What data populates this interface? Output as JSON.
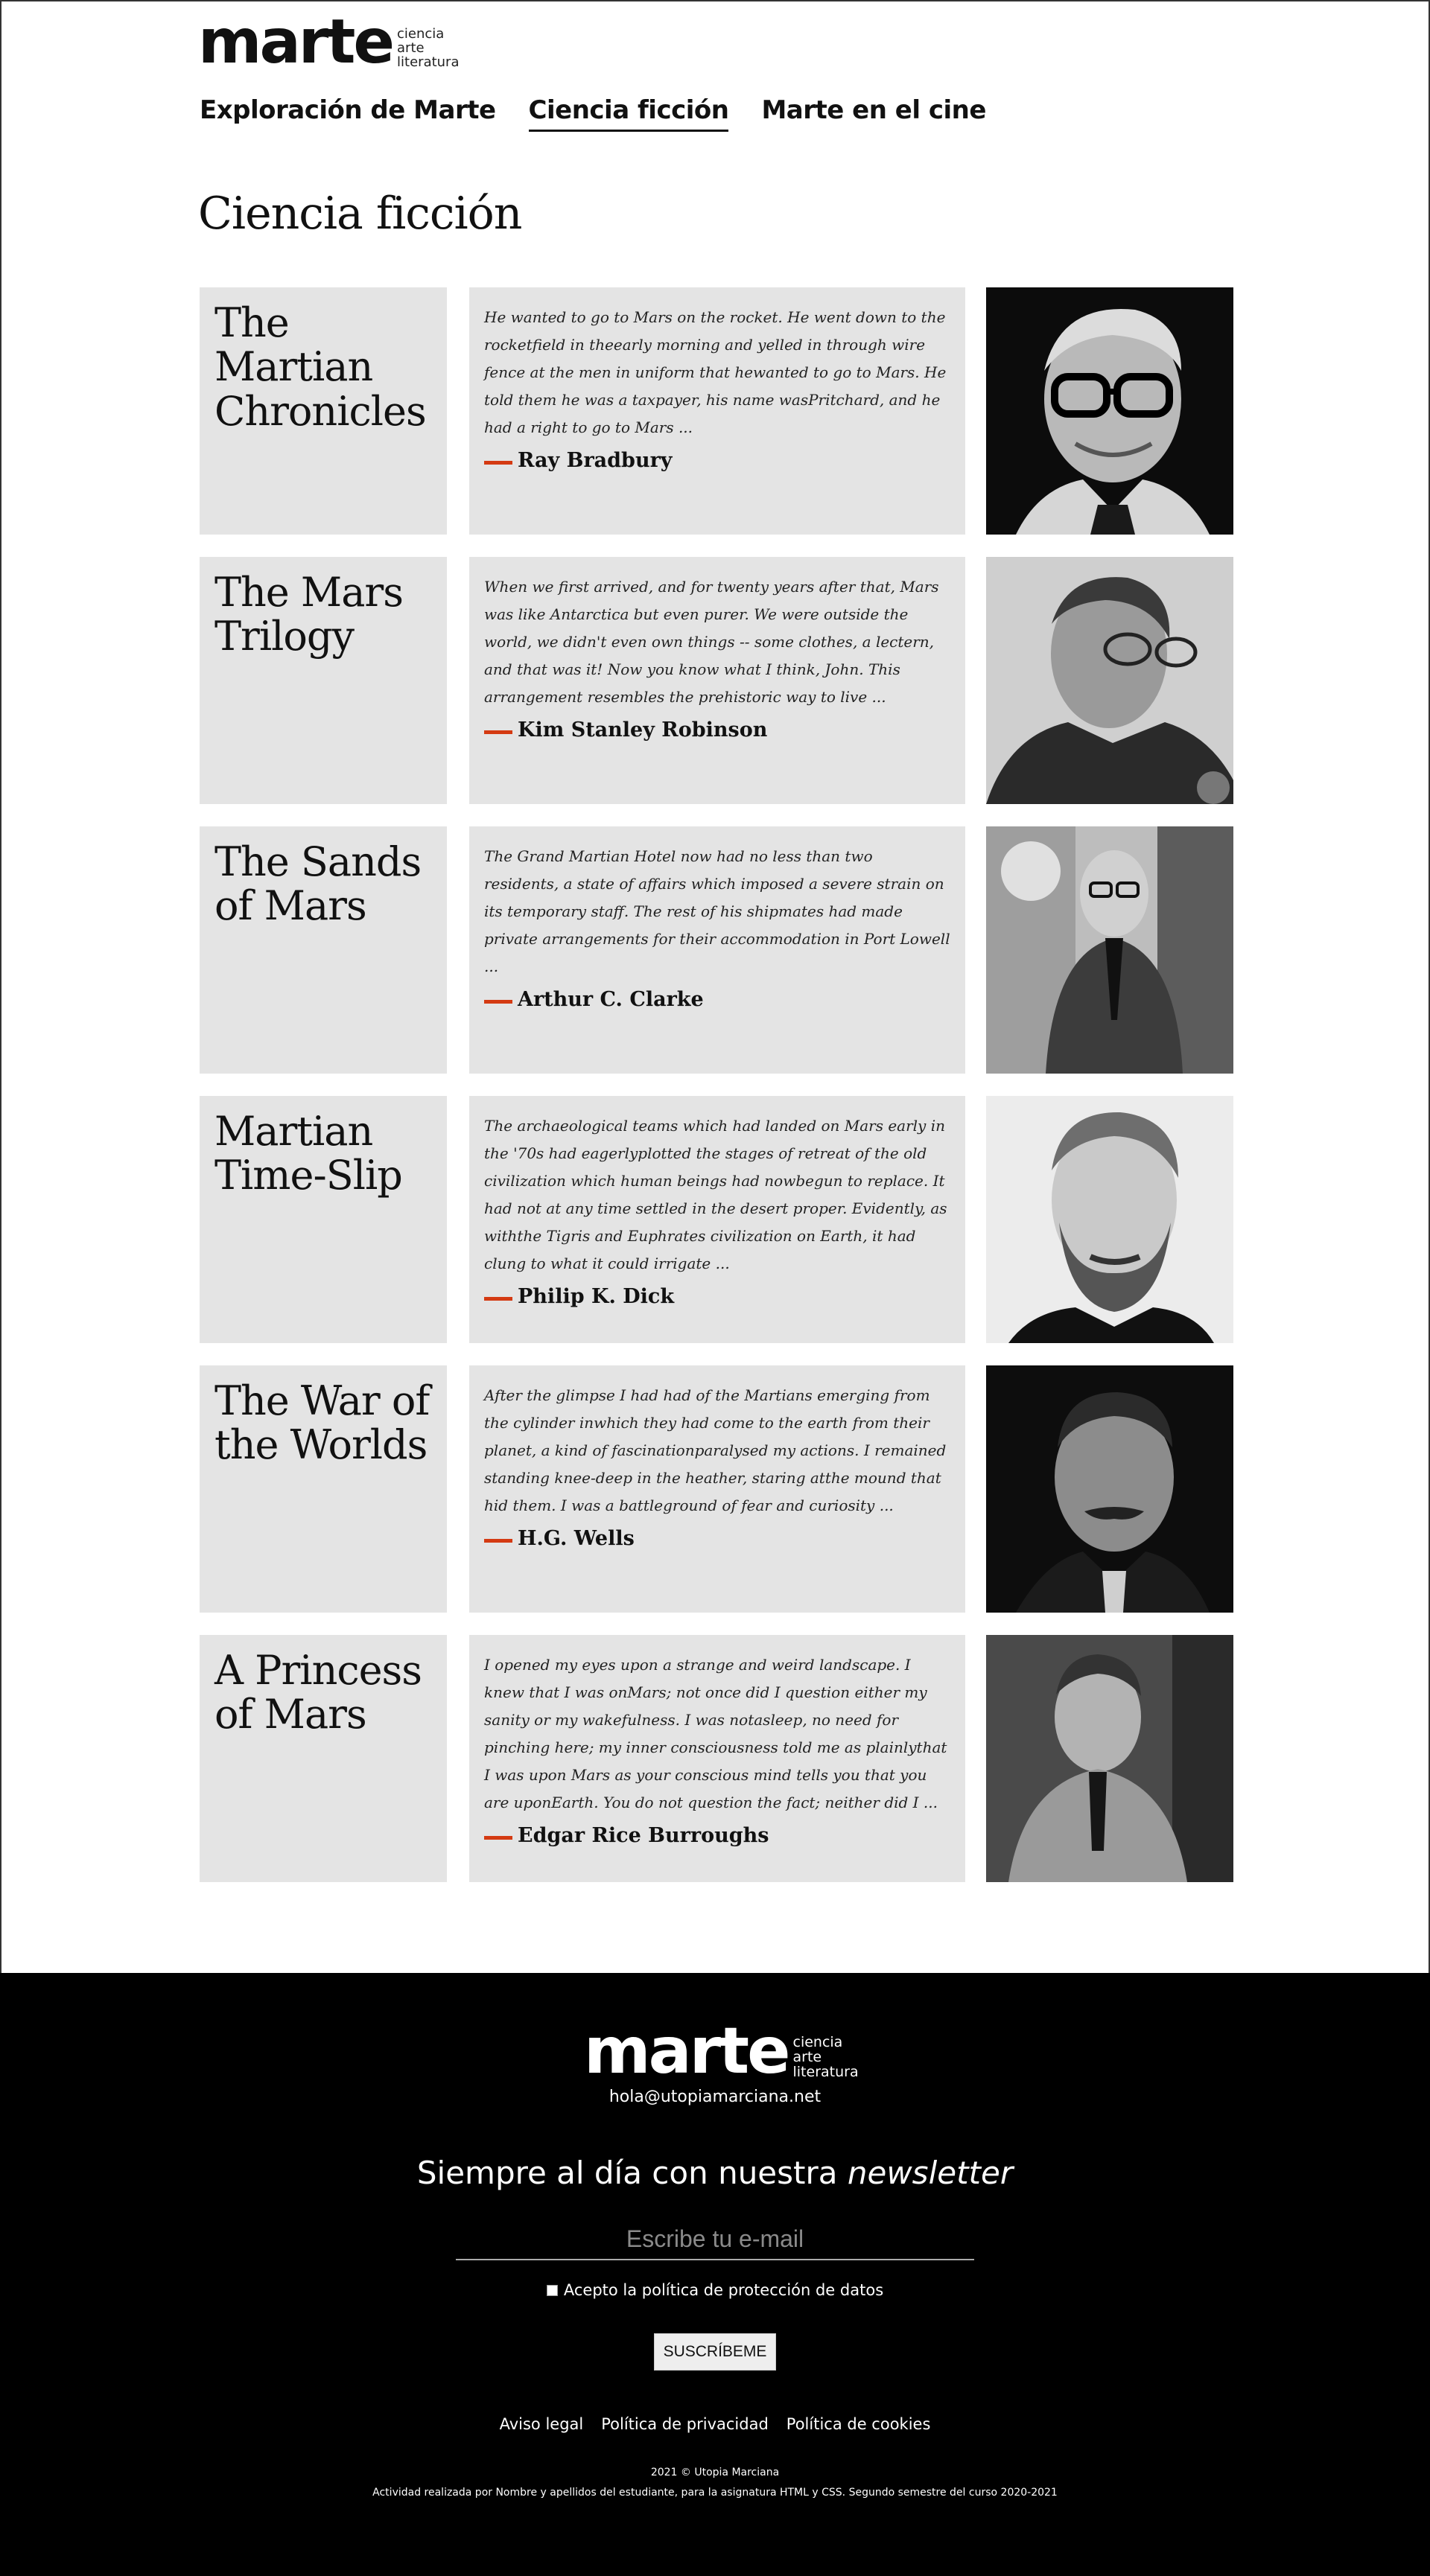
{
  "brand": {
    "name": "marte",
    "tagline": [
      "ciencia",
      "arte",
      "literatura"
    ]
  },
  "nav": [
    {
      "label": "Exploración de Marte",
      "active": false
    },
    {
      "label": "Ciencia ficción",
      "active": true
    },
    {
      "label": "Marte en el cine",
      "active": false
    }
  ],
  "page": {
    "title": "Ciencia ficción"
  },
  "entries": [
    {
      "title": "The Martian Chronicles",
      "quote": "He wanted to go to Mars on the rocket. He went down to the rocketfield in theearly morning and yelled in through wire fence at the men in uniform that hewanted to go to Mars. He told them he was a taxpayer, his name wasPritchard, and he had a right to go to Mars ...",
      "author": "Ray Bradbury"
    },
    {
      "title": "The Mars Trilogy",
      "quote": "When we first arrived, and for twenty years after that, Mars was like Antarctica but even purer. We were outside the world, we didn't even own things -- some clothes, a lectern, and that was it! Now you know what I think, John. This arrangement resembles the prehistoric way to live ...",
      "author": "Kim Stanley Robinson"
    },
    {
      "title": "The Sands of Mars",
      "quote": "The Grand Martian Hotel now had no less than two residents, a state of affairs which imposed a severe strain on its temporary staff. The rest of his shipmates had made private arrangements for their accommodation in Port Lowell ...",
      "author": "Arthur C. Clarke"
    },
    {
      "title": "Martian Time-Slip",
      "quote": "The archaeological teams which had landed on Mars early in the '70s had eagerlyplotted the stages of retreat of the old civilization which human beings had nowbegun to replace. It had not at any time settled in the desert proper. Evidently, as withthe Tigris and Euphrates civilization on Earth, it had clung to what it could irrigate ...",
      "author": "Philip K. Dick"
    },
    {
      "title": "The War of the Worlds",
      "quote": "After the glimpse I had had of the Martians emerging from the cylinder inwhich they had come to the earth from their planet, a kind of fascinationparalysed my actions. I remained standing knee-deep in the heather, staring atthe mound that hid them. I was a battleground of fear and curiosity ...",
      "author": "H.G. Wells"
    },
    {
      "title": "A Princess of Mars",
      "quote": "I opened my eyes upon a strange and weird landscape. I knew that I was onMars; not once did I question either my sanity or my wakefulness. I was notasleep, no need for pinching here; my inner consciousness told me as plainlythat I was upon Mars as your conscious mind tells you that you are uponEarth. You do not question the fact; neither did I ...",
      "author": "Edgar Rice Burroughs"
    }
  ],
  "footer": {
    "email": "hola@utopiamarciana.net",
    "newsletter_prefix": "Siempre al día con nuestra",
    "newsletter_em": "newsletter",
    "email_placeholder": "Escribe tu e-mail",
    "consent_label": "Acepto la política de protección de datos",
    "subscribe_label": "SUSCRÍBEME",
    "links": [
      "Aviso legal",
      "Política de privacidad",
      "Política de cookies"
    ],
    "copyright": "2021 © Utopia Marciana",
    "credit": "Actividad realizada por Nombre y apellidos del estudiante, para la asignatura HTML y CSS. Segundo semestre del curso 2020-2021"
  }
}
